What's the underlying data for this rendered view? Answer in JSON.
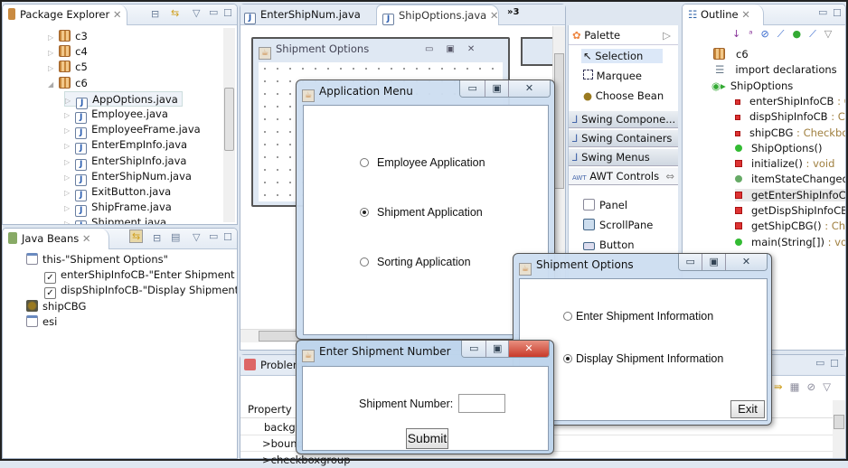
{
  "package_explorer": {
    "title": "Package Explorer",
    "items": [
      {
        "label": "c3",
        "type": "package",
        "depth": 1
      },
      {
        "label": "c4",
        "type": "package",
        "depth": 1
      },
      {
        "label": "c5",
        "type": "package",
        "depth": 1
      },
      {
        "label": "c6",
        "type": "package",
        "depth": 1,
        "expanded": true
      },
      {
        "label": "AppOptions.java",
        "type": "java",
        "depth": 2,
        "selected": true
      },
      {
        "label": "Employee.java",
        "type": "java",
        "depth": 2
      },
      {
        "label": "EmployeeFrame.java",
        "type": "java",
        "depth": 2
      },
      {
        "label": "EnterEmpInfo.java",
        "type": "java",
        "depth": 2
      },
      {
        "label": "EnterShipInfo.java",
        "type": "java",
        "depth": 2
      },
      {
        "label": "EnterShipNum.java",
        "type": "java",
        "depth": 2
      },
      {
        "label": "ExitButton.java",
        "type": "java",
        "depth": 2
      },
      {
        "label": "ShipFrame.java",
        "type": "java",
        "depth": 2
      },
      {
        "label": "Shipment.java",
        "type": "java",
        "depth": 2
      }
    ]
  },
  "java_beans": {
    "title": "Java Beans",
    "items": [
      {
        "label": "this-\"Shipment Options\"",
        "icon": "frame"
      },
      {
        "label": "enterShipInfoCB-\"Enter Shipment Info",
        "icon": "checkbox"
      },
      {
        "label": "dispShipInfoCB-\"Display Shipment Inf.",
        "icon": "checkbox"
      },
      {
        "label": "shipCBG",
        "icon": "bean"
      },
      {
        "label": "esi",
        "icon": "frame"
      }
    ]
  },
  "editor": {
    "tabs": [
      {
        "label": "EnterShipNum.java"
      },
      {
        "label": "ShipOptions.java",
        "active": true
      }
    ],
    "overflow": "»3",
    "design_frame_title": "Shipment Options"
  },
  "palette": {
    "title": "Palette",
    "tools": [
      "Selection",
      "Marquee",
      "Choose Bean"
    ],
    "drawers": [
      "Swing Compone...",
      "Swing Containers",
      "Swing Menus",
      "AWT Controls"
    ],
    "awt_items": [
      "Panel",
      "ScrollPane",
      "Button"
    ]
  },
  "outline": {
    "title": "Outline",
    "items": [
      {
        "label": "c6",
        "type": ""
      },
      {
        "label": "import declarations",
        "type": ""
      },
      {
        "label": "ShipOptions",
        "type": ""
      },
      {
        "label": "enterShipInfoCB",
        "type": " : C",
        "kind": "field"
      },
      {
        "label": "dispShipInfoCB",
        "type": " : Ch",
        "kind": "field"
      },
      {
        "label": "shipCBG",
        "type": " : Checkbox",
        "kind": "field"
      },
      {
        "label": "ShipOptions()",
        "type": "",
        "kind": "ctor"
      },
      {
        "label": "initialize()",
        "type": " : void",
        "kind": "method"
      },
      {
        "label": "itemStateChanged(",
        "type": "",
        "kind": "override"
      },
      {
        "label": "getEnterShipInfoCB",
        "type": "",
        "kind": "method",
        "selected": true
      },
      {
        "label": "getDispShipInfoCB(",
        "type": "",
        "kind": "method"
      },
      {
        "label": "getShipCBG()",
        "type": " : Chec",
        "kind": "method"
      },
      {
        "label": "main(String[])",
        "type": " : void",
        "kind": "static"
      }
    ]
  },
  "problems": {
    "tab": "Problems",
    "header": "Property",
    "rows": [
      "backgr",
      "&gt;boun",
      ">checkboxgroup"
    ]
  },
  "app_menu": {
    "title": "Application Menu",
    "options": [
      {
        "label": "Employee Application",
        "selected": false
      },
      {
        "label": "Shipment Application",
        "selected": true
      },
      {
        "label": "Sorting Application",
        "selected": false
      }
    ]
  },
  "ship_options": {
    "title": "Shipment Options",
    "options": [
      {
        "label": "Enter Shipment Information",
        "selected": false
      },
      {
        "label": "Display Shipment Information",
        "selected": true
      }
    ],
    "exit_label": "Exit"
  },
  "enter_ship_num": {
    "title": "Enter Shipment Number",
    "field_label": "Shipment Number:",
    "field_value": "",
    "submit_label": "Submit"
  }
}
